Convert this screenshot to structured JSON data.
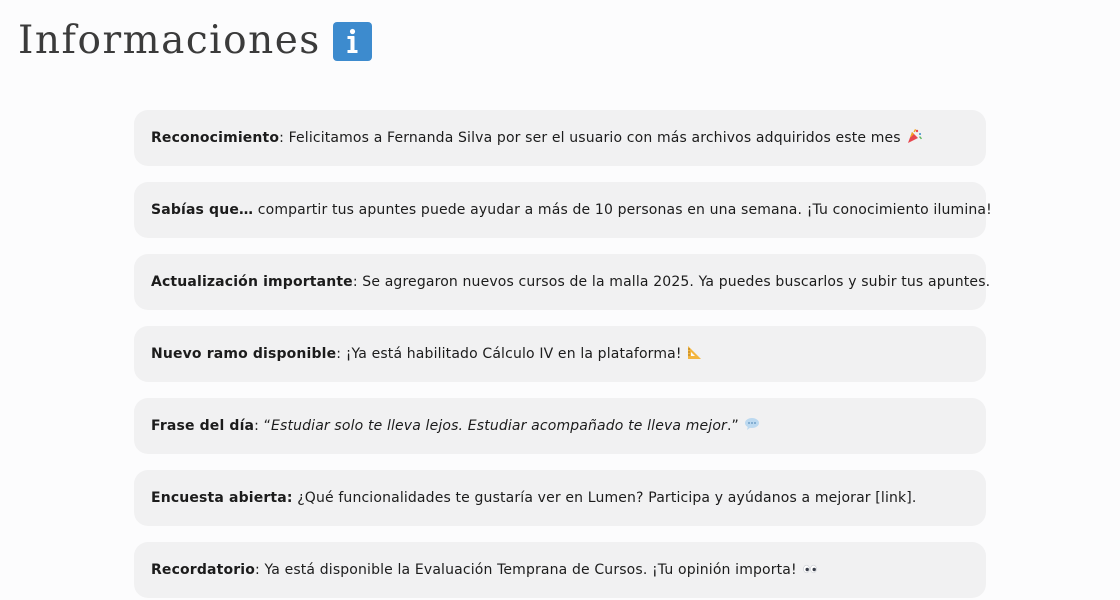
{
  "header": {
    "title": "Informaciones",
    "icon": "info-icon"
  },
  "colors": {
    "accent": "#3d8bce",
    "card_background": "#f1f1f2",
    "page_background": "#fcfcfd"
  },
  "items": [
    {
      "label": "Reconocimiento",
      "separator": ": ",
      "text": "Felicitamos a Fernanda Silva por ser el usuario con más archivos adquiridos este mes",
      "icon": "party-popper-icon"
    },
    {
      "label": "Sabías que…",
      "separator": " ",
      "text": "compartir tus apuntes puede ayudar a más de 10 personas en una semana. ¡Tu conocimiento ilumina!"
    },
    {
      "label": "Actualización importante",
      "separator": ": ",
      "text": "Se agregaron nuevos cursos de la malla 2025. Ya puedes buscarlos y subir tus apuntes."
    },
    {
      "label": "Nuevo ramo disponible",
      "separator": ": ",
      "text": "¡Ya está habilitado Cálculo IV en la plataforma!",
      "icon": "triangular-ruler-icon"
    },
    {
      "label": "Frase del día",
      "separator": ": “",
      "quote": "Estudiar solo te lleva lejos. Estudiar acompañado te lleva mejor",
      "quote_end": ".”",
      "icon": "speech-bubble-icon"
    },
    {
      "label": "Encuesta abierta:",
      "separator": " ",
      "text": "¿Qué funcionalidades te gustaría ver en Lumen? Participa y ayúdanos a mejorar [link]."
    },
    {
      "label": "Recordatorio",
      "separator": ": ",
      "text": "Ya está disponible la Evaluación Temprana de Cursos. ¡Tu opinión importa!",
      "icon": "eyes-icon"
    }
  ]
}
